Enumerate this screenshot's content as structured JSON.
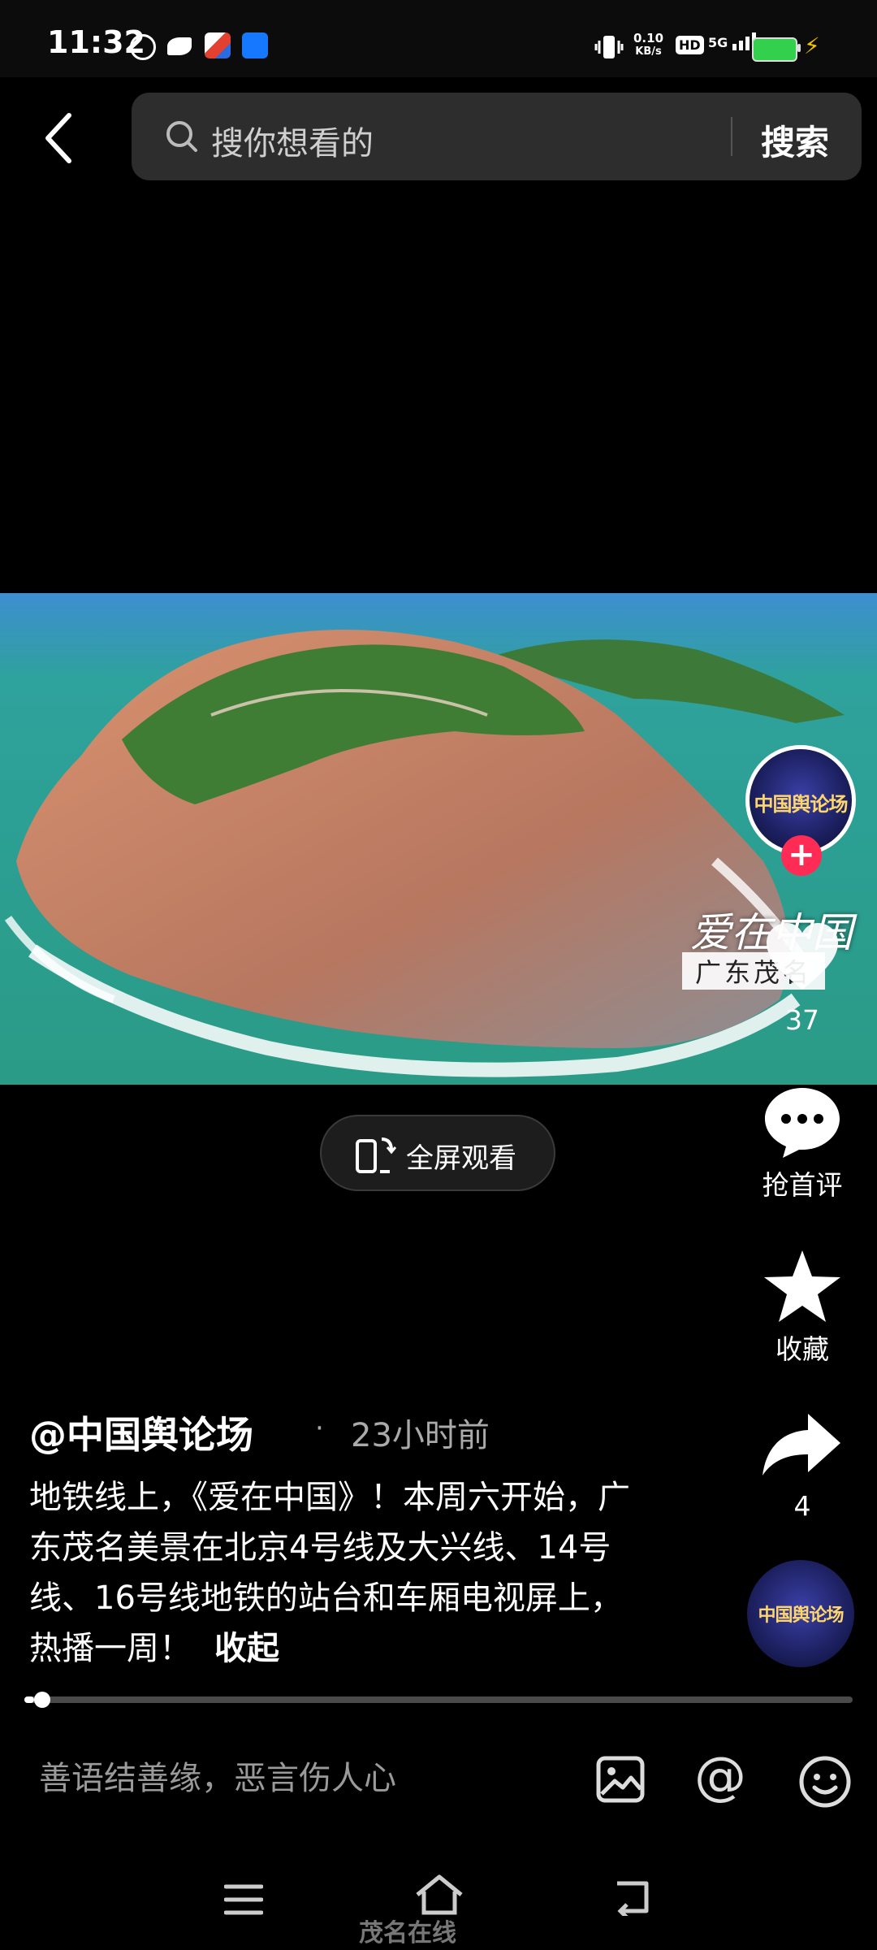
{
  "status_bar": {
    "time": "11:32",
    "net_speed_value": "0.10",
    "net_speed_unit": "KB/s",
    "hd_badge": "HD",
    "signal": "5G",
    "battery_color": "#33d04d"
  },
  "search": {
    "placeholder": "搜你想看的",
    "button_label": "搜索"
  },
  "video": {
    "watermark_title": "爱在中国",
    "watermark_sub": "广东茂名",
    "fullscreen_label": "全屏观看"
  },
  "actions": {
    "avatar_text": "中国舆论场",
    "follow_icon": "+",
    "like_count": "37",
    "comment_label": "抢首评",
    "favorite_label": "收藏",
    "share_count": "4",
    "disc_text": "中国舆论场"
  },
  "post": {
    "author": "@中国舆论场",
    "dot": "·",
    "time_ago": "23小时前",
    "caption": "地铁线上，《爱在中国》！本周六开始，广东茂名美景在北京4号线及大兴线、14号线、16号线地铁的站台和车厢电视屏上，热播一周！",
    "collapse_label": "收起",
    "progress": 0.012
  },
  "comment_bar": {
    "placeholder": "善语结善缘，恶言伤人心",
    "mention_symbol": "@"
  },
  "watermark": {
    "site": "茂名在线"
  },
  "colors": {
    "accent_red": "#fe2c55",
    "background": "#000000",
    "search_box": "#2d2d2d"
  }
}
